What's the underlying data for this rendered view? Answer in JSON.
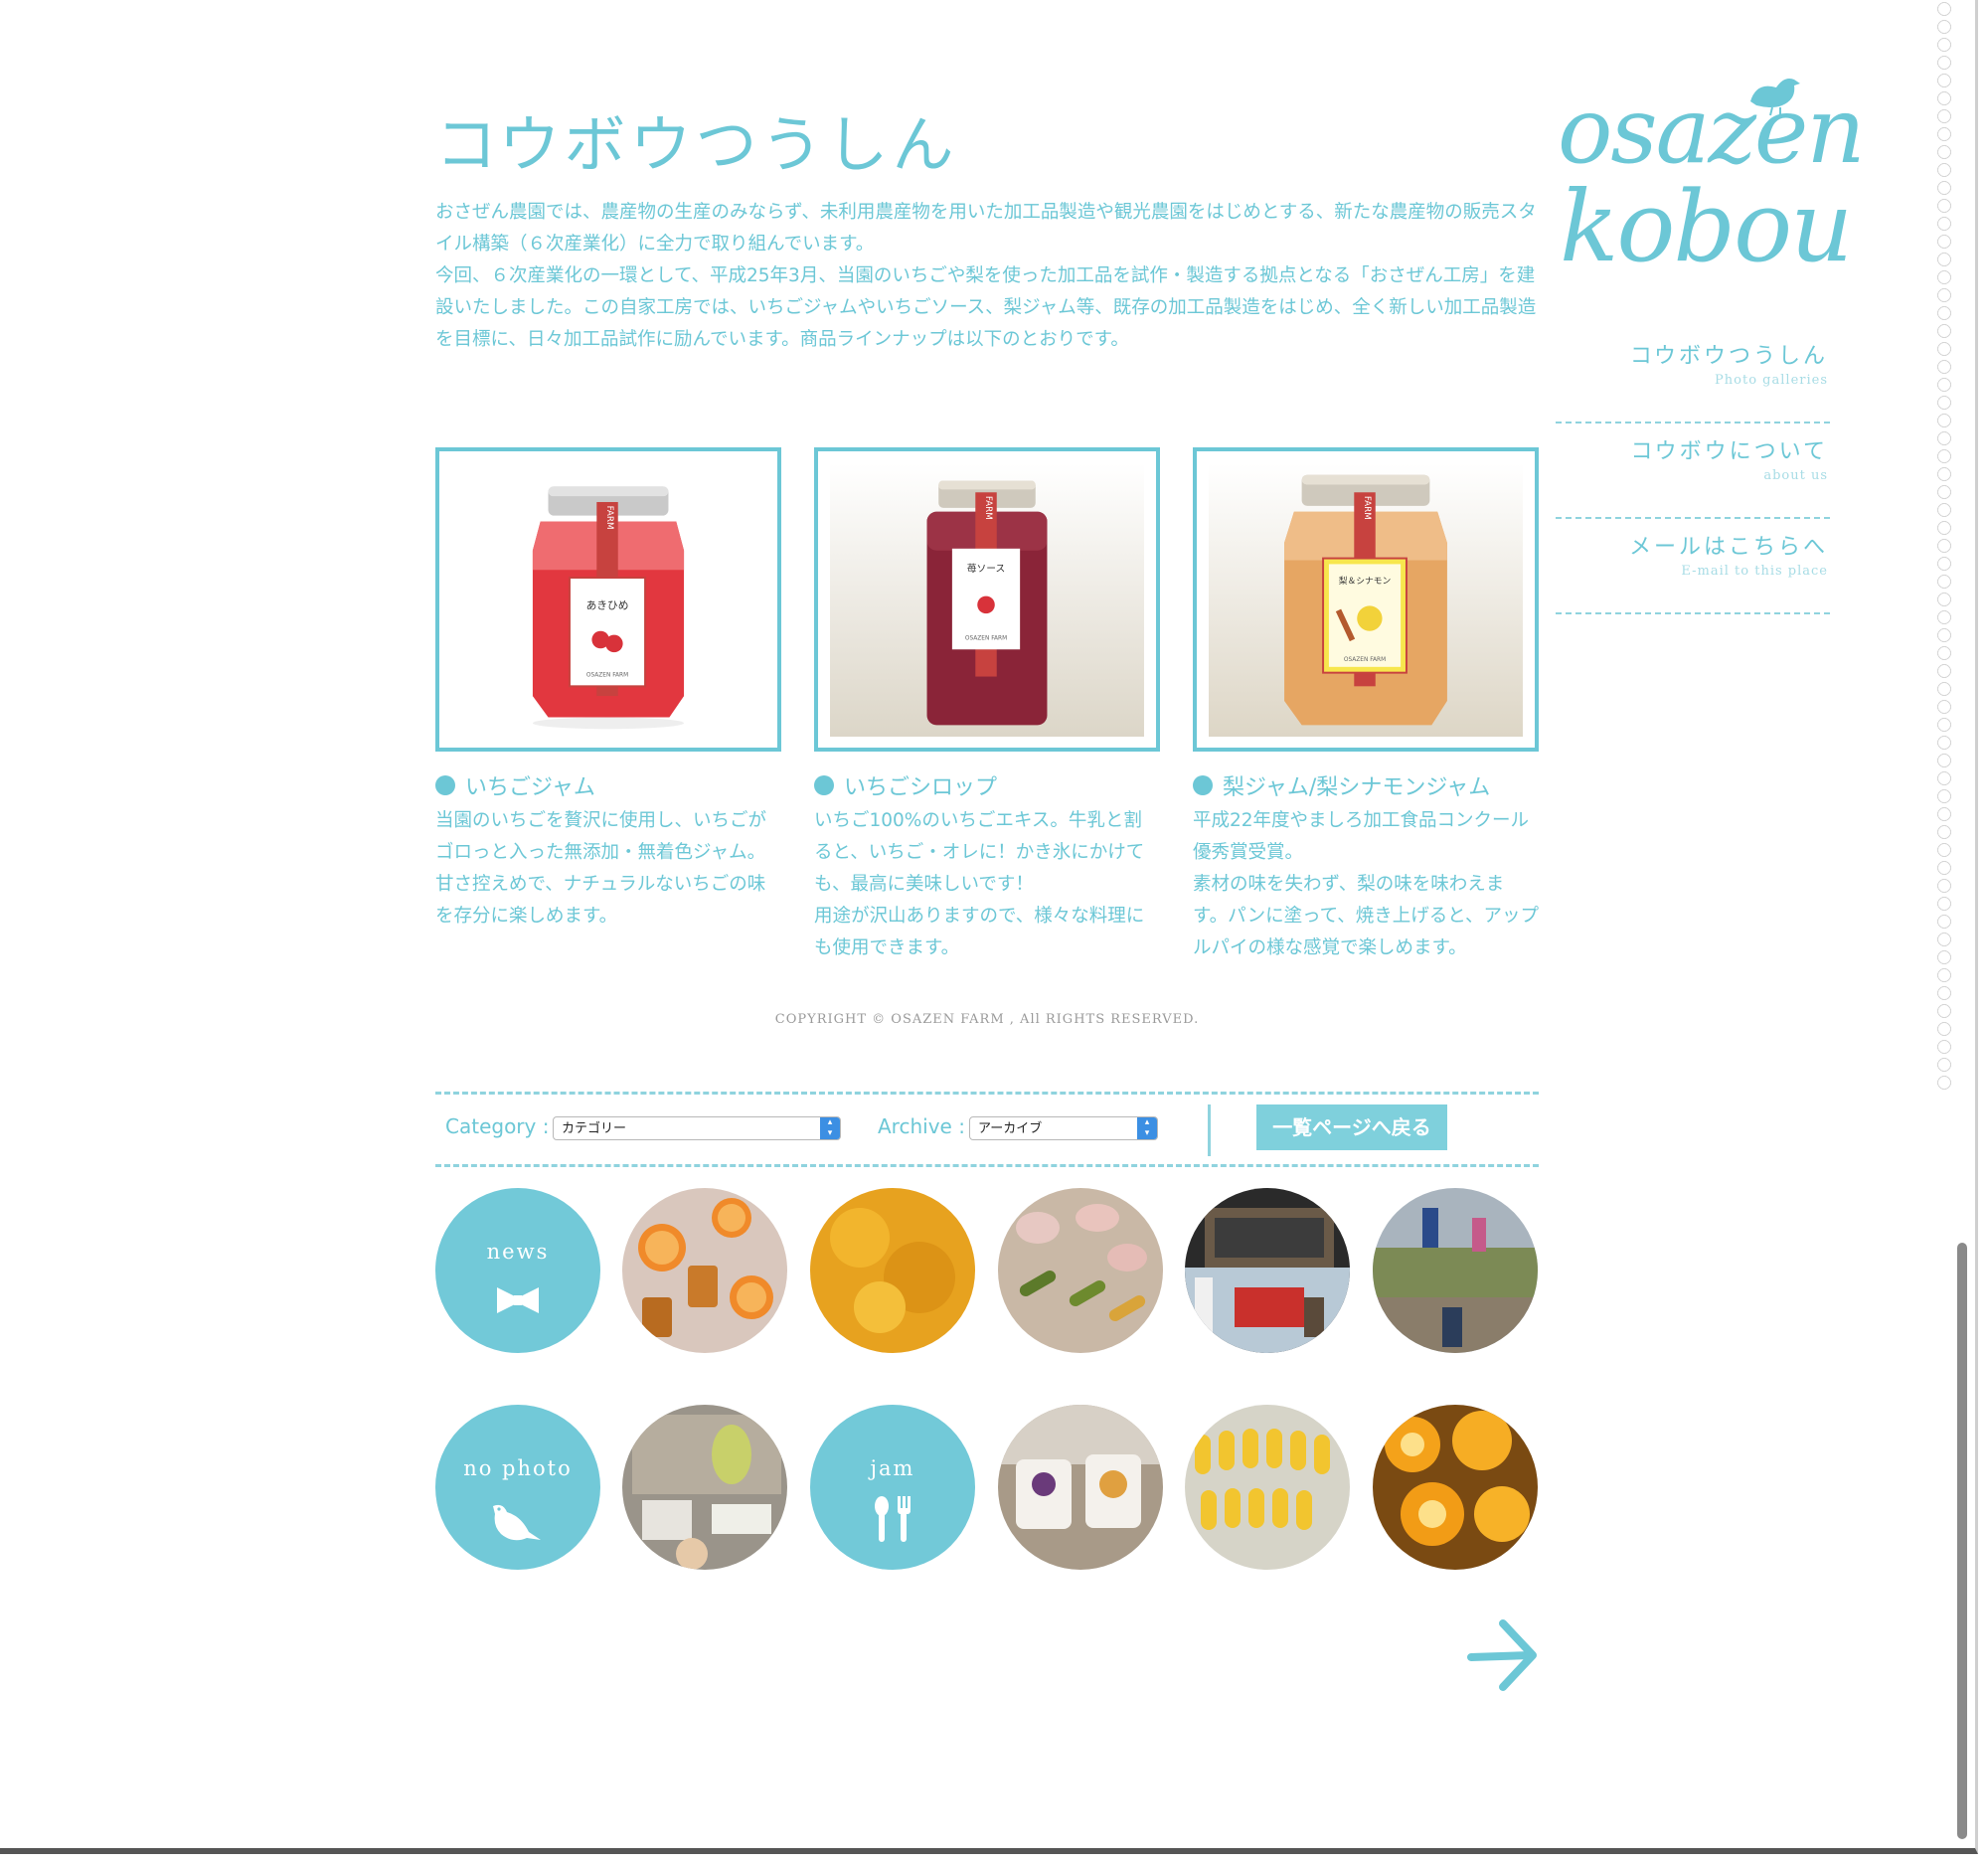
{
  "page": {
    "title": "コウボウつうしん",
    "intro_paragraphs": [
      "おさぜん農園では、農産物の生産のみならず、未利用農産物を用いた加工品製造や観光農園をはじめとする、新たな農産物の販売スタイル構築（６次産業化）に全力で取り組んでいます。",
      "今回、６次産業化の一環として、平成25年3月、当園のいちごや梨を使った加工品を試作・製造する拠点となる「おさぜん工房」を建設いたしました。この自家工房では、いちごジャムやいちごソース、梨ジャム等、既存の加工品製造をはじめ、全く新しい加工品製造を目標に、日々加工品試作に励んでいます。商品ラインナップは以下のとおりです。"
    ]
  },
  "products": [
    {
      "name": "いちごジャム",
      "jar_label": "あきひめ",
      "description": "当園のいちごを贅沢に使用し、いちごがゴロっと入った無添加・無着色ジャム。\n甘さ控えめで、ナチュラルないちごの味を存分に楽しめます。"
    },
    {
      "name": "いちごシロップ",
      "jar_label": "苺ソース",
      "description": "いちご100%のいちごエキス。牛乳と割ると、いちご・オレに！かき氷にかけても、最高に美味しいです！\n用途が沢山ありますので、様々な料理にも使用できます。"
    },
    {
      "name": "梨ジャム/梨シナモンジャム",
      "jar_label": "梨＆シナモン",
      "description": "平成22年度やましろ加工食品コンクール優秀賞受賞。\n素材の味を失わず、梨の味を味わえます。パンに塗って、焼き上げると、アップルパイの様な感覚で楽しめます。"
    }
  ],
  "jar_brand": "FARM",
  "jar_footer": "OSAZEN FARM",
  "footer": {
    "copyright": "COPYRIGHT © OSAZEN FARM , All RIGHTS RESERVED."
  },
  "filter": {
    "category_label": "Category :",
    "category_value": "カテゴリー",
    "archive_label": "Archive :",
    "archive_value": "アーカイブ",
    "back_button": "一覧ページへ戻る"
  },
  "gallery": {
    "news_label": "news",
    "no_photo_label": "no photo",
    "jam_label": "jam"
  },
  "sidebar": {
    "logo_line1": "osazen",
    "logo_line2": "kobou",
    "nav": [
      {
        "jp": "コウボウつうしん",
        "en": "Photo galleries"
      },
      {
        "jp": "コウボウについて",
        "en": "about us"
      },
      {
        "jp": "メールはこちらへ",
        "en": "E-mail to this place"
      }
    ]
  },
  "colors": {
    "accent": "#6cc7d6",
    "button": "#7fd0dc",
    "select_arrow": "#3c8fe3"
  }
}
